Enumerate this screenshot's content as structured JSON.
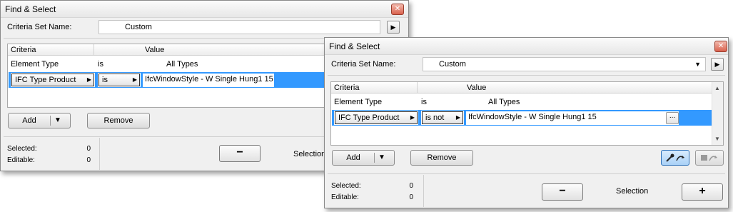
{
  "dialog_back": {
    "title": "Find & Select",
    "close": "✕",
    "criteria_set_label": "Criteria Set Name:",
    "criteria_set_value": "Custom",
    "columns": [
      "Criteria",
      "Value"
    ],
    "rows": [
      {
        "criteria": "Element Type",
        "operator": "is",
        "value": "All Types"
      },
      {
        "criteria": "IFC Type Product",
        "operator": "is",
        "value": "IfcWindowStyle - W Single Hung1 15"
      }
    ],
    "add_label": "Add",
    "remove_label": "Remove",
    "selected_label": "Selected:",
    "selected_value": "0",
    "editable_label": "Editable:",
    "editable_value": "0",
    "minus_label": "−",
    "selection_label": "Selection"
  },
  "dialog_front": {
    "title": "Find & Select",
    "close": "✕",
    "criteria_set_label": "Criteria Set Name:",
    "criteria_set_value": "Custom",
    "columns": [
      "Criteria",
      "Value"
    ],
    "rows": [
      {
        "criteria": "Element Type",
        "operator": "is",
        "value": "All Types"
      },
      {
        "criteria": "IFC Type Product",
        "operator": "is not",
        "value": "IfcWindowStyle - W Single Hung1 15"
      }
    ],
    "dots": "...",
    "add_label": "Add",
    "remove_label": "Remove",
    "selected_label": "Selected:",
    "selected_value": "0",
    "editable_label": "Editable:",
    "editable_value": "0",
    "minus_label": "−",
    "selection_label": "Selection",
    "plus_label": "+"
  },
  "colors": {
    "selection_row": "#3399ff",
    "close_button": "#d9614d",
    "active_tool": "#bcdcfa"
  },
  "icons": [
    "triangle-right-icon",
    "dropdown-arrow-icon",
    "eyedropper-icon",
    "transfer-icon",
    "close-icon"
  ]
}
